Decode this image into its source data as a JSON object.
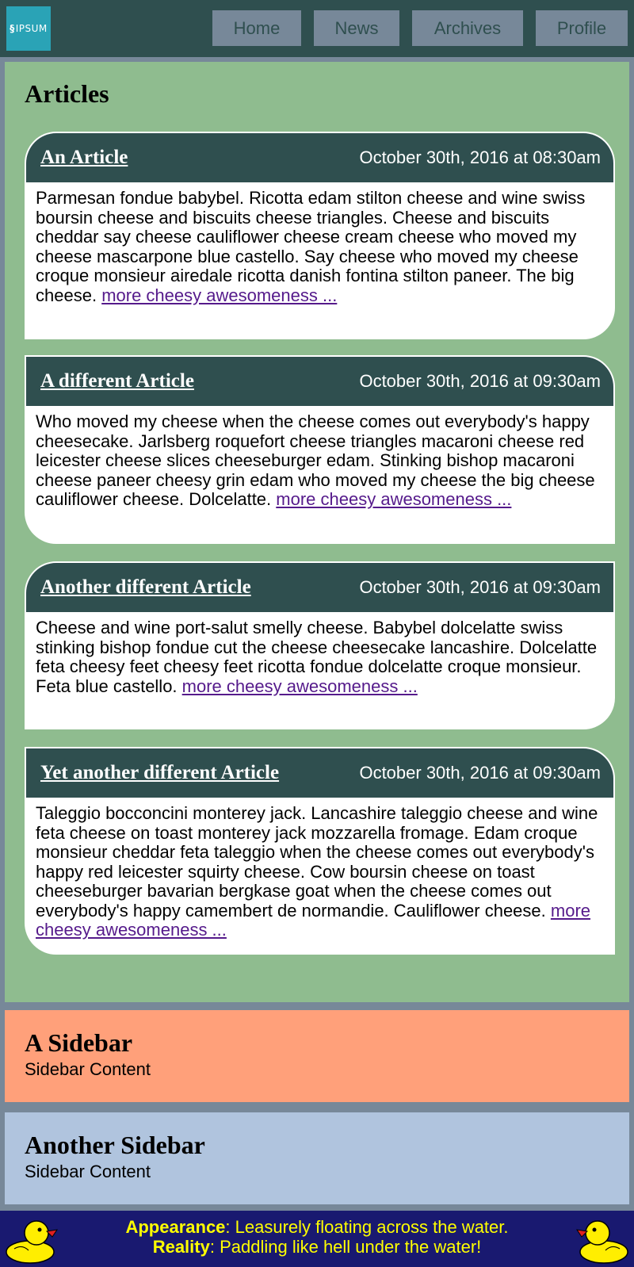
{
  "header": {
    "logo_text": "IPSUM",
    "nav": [
      "Home",
      "News",
      "Archives",
      "Profile"
    ]
  },
  "main": {
    "title": "Articles",
    "more_link": "more cheesy awesomeness ...",
    "articles": [
      {
        "title": "An Article",
        "date": "October 30th, 2016 at 08:30am",
        "body": "Parmesan fondue babybel. Ricotta edam stilton cheese and wine swiss boursin cheese and biscuits cheese triangles. Cheese and biscuits cheddar say cheese cauliflower cheese cream cheese who moved my cheese mascarpone blue castello. Say cheese who moved my cheese croque monsieur airedale ricotta danish fontina stilton paneer. The big cheese."
      },
      {
        "title": "A different Article",
        "date": "October 30th, 2016 at 09:30am",
        "body": "Who moved my cheese when the cheese comes out everybody's happy cheesecake. Jarlsberg roquefort cheese triangles macaroni cheese red leicester cheese slices cheeseburger edam. Stinking bishop macaroni cheese paneer cheesy grin edam who moved my cheese the big cheese cauliflower cheese. Dolcelatte."
      },
      {
        "title": "Another different Article",
        "date": "October 30th, 2016 at 09:30am",
        "body": "Cheese and wine port-salut smelly cheese. Babybel dolcelatte swiss stinking bishop fondue cut the cheese cheesecake lancashire. Dolcelatte feta cheesy feet cheesy feet ricotta fondue dolcelatte croque monsieur. Feta blue castello."
      },
      {
        "title": "Yet another different Article",
        "date": "October 30th, 2016 at 09:30am",
        "body": "Taleggio bocconcini monterey jack. Lancashire taleggio cheese and wine feta cheese on toast monterey jack mozzarella fromage. Edam croque monsieur cheddar feta taleggio when the cheese comes out everybody's happy red leicester squirty cheese. Cow boursin cheese on toast cheeseburger bavarian bergkase goat when the cheese comes out everybody's happy camembert de normandie. Cauliflower cheese."
      }
    ]
  },
  "sidebars": [
    {
      "title": "A Sidebar",
      "content": "Sidebar Content"
    },
    {
      "title": "Another Sidebar",
      "content": "Sidebar Content"
    }
  ],
  "footer": {
    "line1_label": "Appearance",
    "line1_text": ": Leasurely floating across the water.",
    "line2_label": "Reality",
    "line2_text": ": Paddling like hell under the water!"
  },
  "colors": {
    "header_bg": "#2f4f4f",
    "nav_bg": "#778899",
    "main_bg": "#8fbc8f",
    "sidebar1_bg": "#ffa07a",
    "sidebar2_bg": "#b0c4de",
    "footer_bg": "#191970",
    "footer_text": "#ffff00",
    "link": "#551a8b"
  }
}
